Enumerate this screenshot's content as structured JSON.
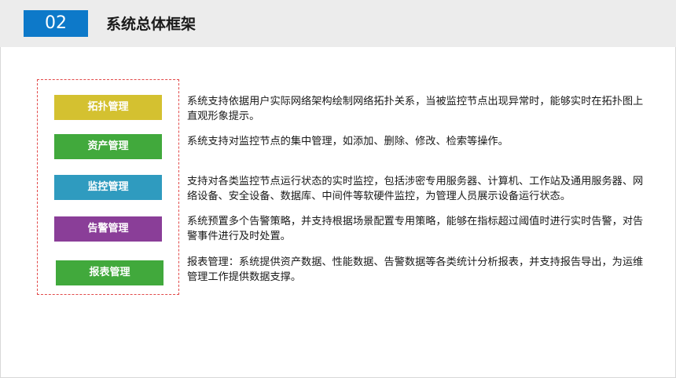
{
  "header": {
    "number": "02",
    "title": "系统总体框架"
  },
  "modules": [
    {
      "label": "拓扑管理",
      "color": "#d4c130",
      "description": "系统支持依据用户实际网络架构绘制网络拓扑关系，当被监控节点出现异常时，能够实时在拓扑图上直观形象提示。"
    },
    {
      "label": "资产管理",
      "color": "#41a93c",
      "description": "系统支持对监控节点的集中管理，如添加、删除、修改、检索等操作。"
    },
    {
      "label": "监控管理",
      "color": "#2f9bbf",
      "description": "支持对各类监控节点运行状态的实时监控，包括涉密专用服务器、计算机、工作站及通用服务器、网络设备、安全设备、数据库、中间件等软硬件监控，为管理人员展示设备运行状态。"
    },
    {
      "label": "告警管理",
      "color": "#8a3e98",
      "description": "系统预置多个告警策略，并支持根据场景配置专用策略，能够在指标超过阈值时进行实时告警，对告警事件进行及时处置。"
    },
    {
      "label": "报表管理",
      "color": "#41a93c",
      "description": "报表管理：系统提供资产数据、性能数据、告警数据等各类统计分析报表，并支持报告导出，为运维管理工作提供数据支撑。"
    }
  ]
}
